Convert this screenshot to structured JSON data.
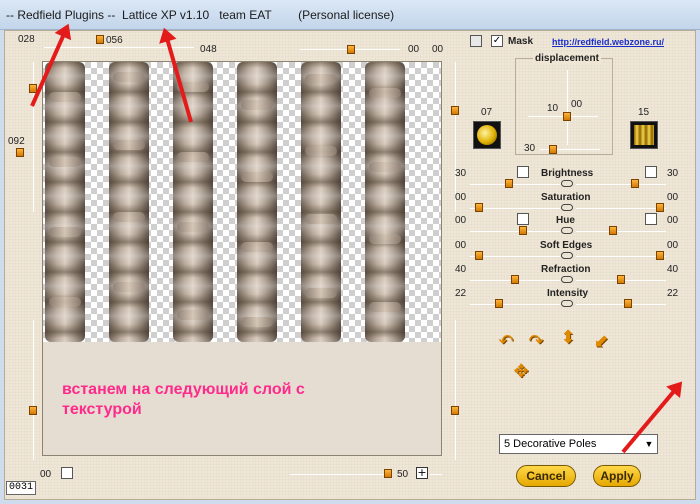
{
  "window": {
    "title": "-- Redfield Plugins --  Lattice XP v1.10   team EAT        (Personal license)"
  },
  "top_sliders": {
    "left_value": "028",
    "knob_value": "056",
    "mid_value": "048",
    "right_a": "00",
    "right_b": "00"
  },
  "left_slider": {
    "value": "092"
  },
  "bottom_bar": {
    "counter": "0031",
    "left_value": "00",
    "right_value": "50"
  },
  "mask": {
    "label": "Mask",
    "checked": true,
    "link_text": "http://redfield.webzone.ru/"
  },
  "displacement": {
    "title": "displacement",
    "x_value": "10",
    "y_value": "00",
    "bottom_value": "30"
  },
  "swatches": {
    "left_value": "07",
    "right_value": "15"
  },
  "parameters": [
    {
      "name": "Brightness",
      "left": "30",
      "right": "30"
    },
    {
      "name": "Saturation",
      "left": "00",
      "right": "00"
    },
    {
      "name": "Hue",
      "left": "00",
      "right": "00"
    },
    {
      "name": "Soft Edges",
      "left": "00",
      "right": "00"
    },
    {
      "name": "Refraction",
      "left": "40",
      "right": "40"
    },
    {
      "name": "Intensity",
      "left": "22",
      "right": "22"
    }
  ],
  "annotation": "встанем на следующий слой с текстурой",
  "preset": {
    "selected": "5 Decorative Poles"
  },
  "buttons": {
    "cancel": "Cancel",
    "apply": "Apply"
  },
  "icons": [
    "rotate-left-icon",
    "rotate-right-icon",
    "flip-vertical-icon",
    "diagonal-arrow-icon",
    "move-icon"
  ],
  "colors": {
    "accent": "#e08a00",
    "annotation": "#ff2a8c",
    "arrow": "#e31b1b",
    "link": "#1a2fc9"
  }
}
